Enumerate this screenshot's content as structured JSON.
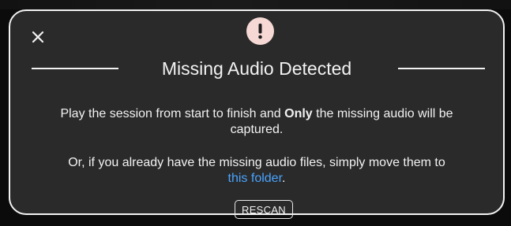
{
  "dialog": {
    "title": "Missing Audio Detected",
    "close_icon": "close-icon",
    "warning_icon": "exclamation-icon",
    "paragraph1": {
      "before": "Play the session from start to finish and ",
      "emphasis": "Only",
      "after": " the missing audio will be captured."
    },
    "paragraph2": {
      "before": "Or, if you already have the missing audio files, simply move them to ",
      "link": "this folder",
      "after": "."
    },
    "rescan_label": "RESCAN"
  },
  "colors": {
    "dialog_bg": "#2a2a2a",
    "border": "#f2f2f2",
    "text": "#f2f2f2",
    "link": "#4aa3ff",
    "warning_badge": "#f6d9d5",
    "warning_mark": "#1c1c1c"
  }
}
